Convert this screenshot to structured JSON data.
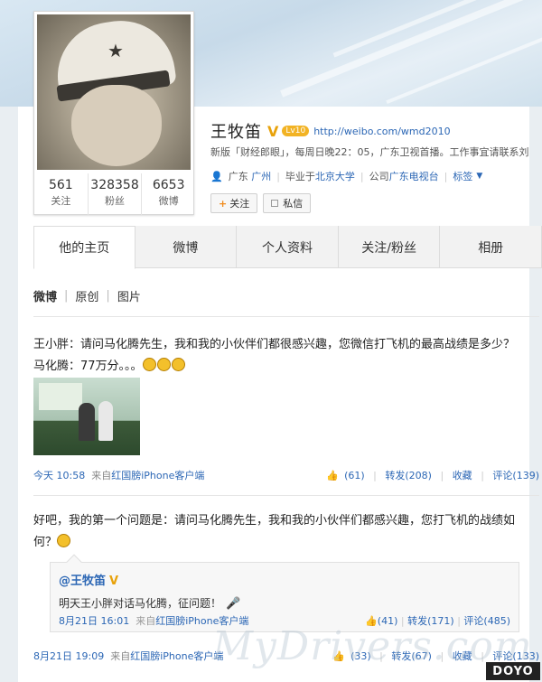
{
  "profile": {
    "name": "王牧笛",
    "verified_mark": "V",
    "level_badge": "Lv10",
    "url": "http://weibo.com/wmd2010",
    "intro": "新版「财经郎眼」，每周日晚22：05，广东卫视首播。工作事宜请联系刘",
    "location_prefix": "广东",
    "location_city": "广州",
    "school_prefix": "毕业于",
    "school": "北京大学",
    "company_prefix": "公司",
    "company": "广东电视台",
    "tags_label": "标签"
  },
  "stats": [
    {
      "value": "561",
      "label": "关注"
    },
    {
      "value": "328358",
      "label": "粉丝"
    },
    {
      "value": "6653",
      "label": "微博"
    }
  ],
  "actions": {
    "follow": "关注",
    "message": "私信"
  },
  "tabs": [
    {
      "label": "他的主页",
      "active": true
    },
    {
      "label": "微博",
      "active": false
    },
    {
      "label": "个人资料",
      "active": false
    },
    {
      "label": "关注/粉丝",
      "active": false
    },
    {
      "label": "相册",
      "active": false
    }
  ],
  "filters": [
    "微博",
    "原创",
    "图片"
  ],
  "posts": [
    {
      "text": "王小胖：请问马化腾先生，我和我的小伙伴们都很感兴趣，您微信打飞机的最高战绩是多少？马化腾：77万分。。。",
      "time": "今天 10:58",
      "source_prefix": "来自",
      "source": "红国膀iPhone客户端",
      "likes": "(61)",
      "repost": "转发(208)",
      "fav": "收藏",
      "comment": "评论(139)"
    },
    {
      "text": "好吧，我的第一个问题是：请问马化腾先生，我和我的小伙伴们都感兴趣，您打飞机的战绩如何？",
      "time": "8月21日 19:09",
      "source_prefix": "来自",
      "source": "红国膀iPhone客户端",
      "likes": "(33)",
      "repost": "转发(67)",
      "fav": "收藏",
      "comment": "评论(133)"
    }
  ],
  "repost": {
    "author": "@王牧笛",
    "verified_mark": "V",
    "body": "明天王小胖对话马化腾，征问题！",
    "time": "8月21日 16:01",
    "source_prefix": "来自",
    "source": "红国膀iPhone客户端",
    "likes": "(41)",
    "repost": "转发(171)",
    "comment": "评论(485)"
  },
  "watermark": "MyDrivers.com",
  "corner_logo": "DOYO",
  "colors": {
    "link": "#2c67b5",
    "verified": "#e8a20b",
    "accent_orange": "#f08b1d"
  }
}
